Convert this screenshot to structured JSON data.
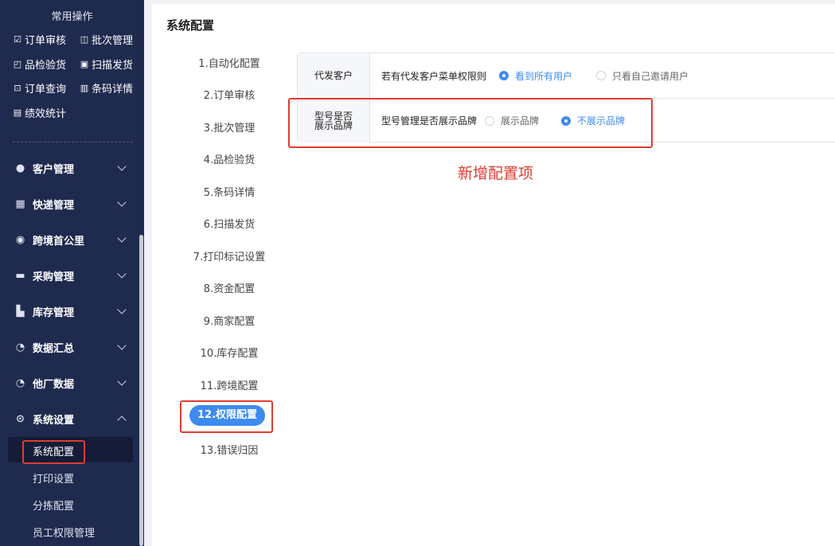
{
  "sidebar": {
    "section_title": "常用操作",
    "quick_actions": [
      {
        "label": "订单审核",
        "icon": "check-square-icon"
      },
      {
        "label": "批次管理",
        "icon": "batch-icon"
      },
      {
        "label": "品检验货",
        "icon": "inspect-icon"
      },
      {
        "label": "扫描发货",
        "icon": "scan-icon"
      },
      {
        "label": "订单查询",
        "icon": "search-order-icon"
      },
      {
        "label": "条码详情",
        "icon": "barcode-icon"
      },
      {
        "label": "绩效统计",
        "icon": "chart-icon"
      }
    ],
    "menus": [
      {
        "label": "客户管理",
        "icon": "user-icon"
      },
      {
        "label": "快递管理",
        "icon": "truck-icon"
      },
      {
        "label": "跨境首公里",
        "icon": "globe-icon"
      },
      {
        "label": "采购管理",
        "icon": "cart-icon"
      },
      {
        "label": "库存管理",
        "icon": "warehouse-icon"
      },
      {
        "label": "数据汇总",
        "icon": "pie-icon"
      },
      {
        "label": "他厂数据",
        "icon": "pie-icon"
      },
      {
        "label": "系统设置",
        "icon": "settings-icon"
      }
    ],
    "submenus": [
      "系统配置",
      "打印设置",
      "分拣配置",
      "员工权限管理"
    ]
  },
  "main": {
    "title": "系统配置",
    "steps": [
      "1.自动化配置",
      "2.订单审核",
      "3.批次管理",
      "4.品检验货",
      "5.条码详情",
      "6.扫描发货",
      "7.打印标记设置",
      "8.资金配置",
      "9.商家配置",
      "10.库存配置",
      "11.跨境配置",
      "12.权限配置",
      "13.错误归因"
    ],
    "config_rows": [
      {
        "label": "代发客户",
        "question": "若有代发客户菜单权限则",
        "options": [
          "看到所有用户",
          "只看自己邀请用户"
        ],
        "selected": 0
      },
      {
        "label_line1": "型号是否",
        "label_line2": "展示品牌",
        "question": "型号管理是否展示品牌",
        "options": [
          "展示品牌",
          "不展示品牌"
        ],
        "selected": 1
      }
    ],
    "annotation": "新增配置项"
  },
  "colors": {
    "sidebar_bg": "#1f2a4f",
    "accent": "#3e8bf0",
    "annotation_red": "#e03b31"
  }
}
